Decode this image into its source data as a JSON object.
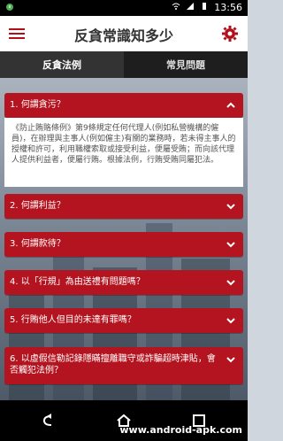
{
  "status": {
    "time": "13:56"
  },
  "app": {
    "title": "反貪常識知多少"
  },
  "tabs": [
    {
      "label": "反貪法例",
      "active": true
    },
    {
      "label": "常見問題",
      "active": false
    }
  ],
  "faq": [
    {
      "label": "1. 何謂貪污？",
      "expanded": true,
      "answer": "《防止賄賂條例》第9條規定任何代理人(例如私營機構的僱員)，在辦理與主事人(例如僱主)有關的業務時，若未得主事人的授權和許可，利用職權索取或接受利益，便屬受賄；而向該代理人提供利益者，便屬行賄。根據法例，行賄受賄同屬犯法。"
    },
    {
      "label": "2. 何謂利益？",
      "expanded": false
    },
    {
      "label": "3. 何謂款待？",
      "expanded": false
    },
    {
      "label": "4. 以「行規」為由送禮有問題嗎？",
      "expanded": false
    },
    {
      "label": "5. 行賄他人但目的未達有罪嗎？",
      "expanded": false
    },
    {
      "label": "6. 以虛假信勒記錄隱瞞擅離職守或詐騙超時津貼，會否觸犯法例？",
      "expanded": false
    }
  ],
  "watermark": "www.android-apk.com",
  "colors": {
    "accent": "#b3141f",
    "appbar": "#ffffff"
  }
}
